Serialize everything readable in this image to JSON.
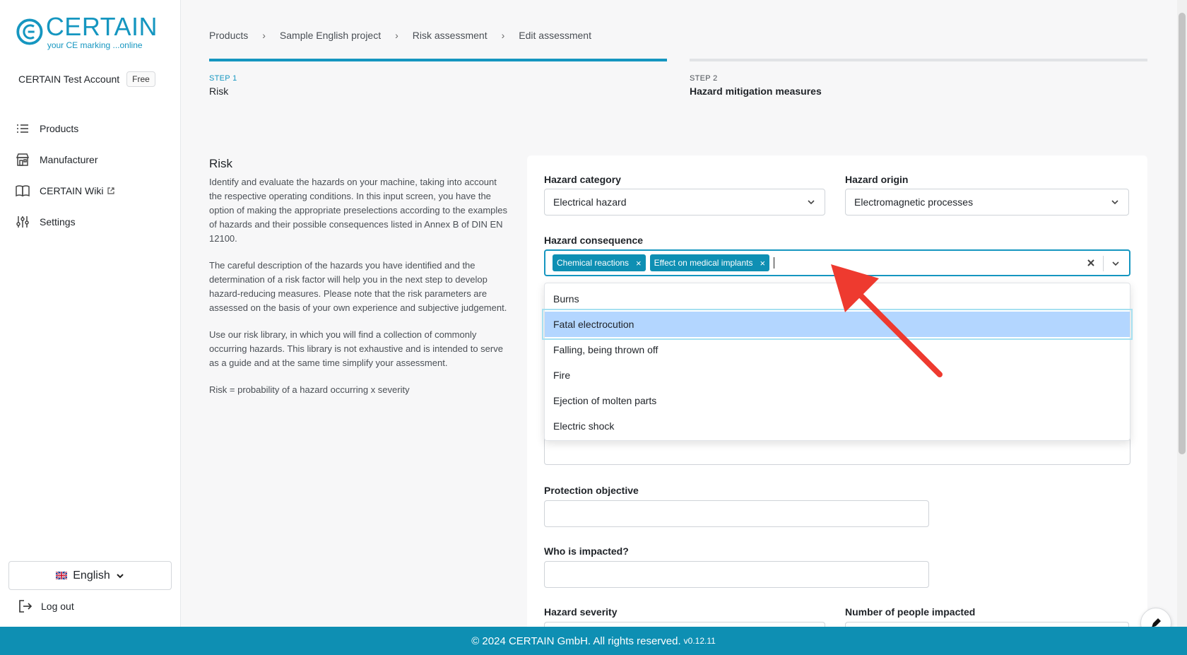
{
  "brand": {
    "title": "CERTAIN",
    "tagline": "your CE marking ...online",
    "color": "#1596c0"
  },
  "account": {
    "name": "CERTAIN Test Account",
    "plan": "Free"
  },
  "sidebar": {
    "items": [
      {
        "label": "Products",
        "icon": "list-icon"
      },
      {
        "label": "Manufacturer",
        "icon": "store-icon"
      },
      {
        "label": "CERTAIN Wiki",
        "icon": "book-icon",
        "external": true
      },
      {
        "label": "Settings",
        "icon": "sliders-icon"
      }
    ],
    "language": "English",
    "logout": "Log out"
  },
  "breadcrumb": [
    "Products",
    "Sample English project",
    "Risk assessment",
    "Edit assessment"
  ],
  "steps": [
    {
      "label": "STEP 1",
      "name": "Risk"
    },
    {
      "label": "STEP 2",
      "name": "Hazard mitigation measures"
    }
  ],
  "intro": {
    "title": "Risk",
    "paragraphs": [
      "Identify and evaluate the hazards on your machine, taking into account the respective operating conditions. In this input screen, you have the option of making the appropriate preselections according to the examples of hazards and their possible consequences listed in Annex B of DIN EN 12100.",
      "The careful description of the hazards you have identified and the determination of a risk factor will help you in the next step to develop hazard-reducing measures. Please note that the risk parameters are assessed on the basis of your own experience and subjective judgement.",
      "Use our risk library, in which you will find a collection of commonly occurring hazards. This library is not exhaustive and is intended to serve as a guide and at the same time simplify your assessment.",
      "Risk = probability of a hazard occurring x severity"
    ]
  },
  "form": {
    "hazard_category": {
      "label": "Hazard category",
      "value": "Electrical hazard"
    },
    "hazard_origin": {
      "label": "Hazard origin",
      "value": "Electromagnetic processes"
    },
    "hazard_consequence": {
      "label": "Hazard consequence",
      "selected": [
        "Chemical reactions",
        "Effect on medical implants"
      ],
      "options": [
        "Burns",
        "Fatal electrocution",
        "Falling, being thrown off",
        "Fire",
        "Ejection of molten parts",
        "Electric shock"
      ],
      "highlighted": "Fatal electrocution"
    },
    "protection_objective": {
      "label": "Protection objective",
      "value": ""
    },
    "who_impacted": {
      "label": "Who is impacted?",
      "value": ""
    },
    "hazard_severity": {
      "label": "Hazard severity"
    },
    "people_impacted": {
      "label": "Number of people impacted"
    }
  },
  "footer": {
    "copyright": "© 2024 CERTAIN GmbH. All rights reserved.",
    "version": "v0.12.11"
  }
}
